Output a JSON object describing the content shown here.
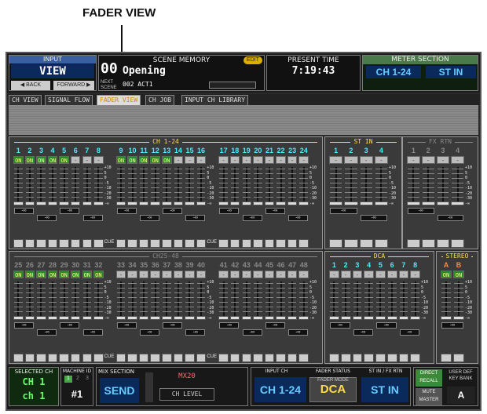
{
  "callout": "FADER VIEW",
  "input": {
    "label": "INPUT",
    "view": "VIEW",
    "back": "◀ BACK",
    "forward": "FORWARD ▶"
  },
  "scene": {
    "number": "00",
    "label": "SCENE MEMORY",
    "edit": "EDIT",
    "title": "Opening",
    "next_label": "NEXT SCENE",
    "next": "002 ACT1"
  },
  "time": {
    "label": "PRESENT TIME",
    "value": "7:19:43"
  },
  "meter": {
    "label": "METER SECTION",
    "ch": "CH 1-24",
    "st": "ST IN"
  },
  "tabs": [
    "CH VIEW",
    "SIGNAL FLOW",
    "FADER VIEW",
    "CH JOB",
    "INPUT CH LIBRARY"
  ],
  "groups": {
    "ch1_24": {
      "title": "CH 1-24",
      "channels": [
        "1",
        "2",
        "3",
        "4",
        "5",
        "6",
        "7",
        "8",
        "9",
        "10",
        "11",
        "12",
        "13",
        "14",
        "15",
        "16",
        "17",
        "18",
        "19",
        "20",
        "21",
        "22",
        "23",
        "24"
      ],
      "on": [
        "ON",
        "ON",
        "ON",
        "ON",
        "ON",
        "-",
        "-",
        "-",
        "ON",
        "ON",
        "ON",
        "ON",
        "ON",
        "-",
        "-",
        "-",
        "-",
        "-",
        "-",
        "-",
        "-",
        "-",
        "-",
        "-"
      ]
    },
    "ch25_48": {
      "title": "CH25-48",
      "channels": [
        "25",
        "26",
        "27",
        "28",
        "29",
        "30",
        "31",
        "32",
        "33",
        "34",
        "35",
        "36",
        "37",
        "38",
        "39",
        "40",
        "41",
        "42",
        "43",
        "44",
        "45",
        "46",
        "47",
        "48"
      ],
      "on": [
        "ON",
        "ON",
        "ON",
        "ON",
        "ON",
        "ON",
        "ON",
        "ON",
        "-",
        "-",
        "-",
        "-",
        "-",
        "-",
        "-",
        "-",
        "-",
        "-",
        "-",
        "-",
        "-",
        "-",
        "-",
        "-"
      ]
    },
    "st_in": {
      "title": "ST IN",
      "channels": [
        "1",
        "2",
        "3",
        "4"
      ],
      "on": [
        "-",
        "-",
        "-",
        "-"
      ]
    },
    "fx_rtn": {
      "title": "FX RTN",
      "channels": [
        "1",
        "2",
        "3",
        "4"
      ],
      "on": [
        "-",
        "-",
        "-",
        "-"
      ]
    },
    "dca": {
      "title": "DCA",
      "channels": [
        "1",
        "2",
        "3",
        "4",
        "5",
        "6",
        "7",
        "8"
      ],
      "on": [
        "-",
        "-",
        "-",
        "-",
        "-",
        "-",
        "-",
        "-"
      ]
    },
    "stereo": {
      "title": "STEREO",
      "channels": [
        "A",
        "B"
      ],
      "on": [
        "ON",
        "ON"
      ]
    }
  },
  "scale": [
    "+10",
    "5",
    "0",
    "-5",
    "-10",
    "-20",
    "-30",
    "-∞"
  ],
  "value": "-∞",
  "cue": "CUE",
  "bottom": {
    "sel_label": "SELECTED CH",
    "sel_ch": "CH 1",
    "sel_name": "ch 1",
    "machine_label": "MACHINE ID",
    "machine_ids": [
      "1",
      "2",
      "3"
    ],
    "machine": "#1",
    "mix_label": "MIX SECTION",
    "send": "SEND",
    "mix": "MX20",
    "ch_level": "CH LEVEL",
    "input_ch_label": "INPUT CH",
    "fader_status": "FADER STATUS",
    "stin_label": "ST IN / FX RTN",
    "input_ch": "CH 1-24",
    "fader_mode_label": "FADER MODE",
    "fader_mode": "DCA",
    "stin": "ST IN",
    "direct": "DIRECT RECALL",
    "mute": "MUTE MASTER",
    "userdef": "USER DEF KEY BANK",
    "bank": "A"
  }
}
